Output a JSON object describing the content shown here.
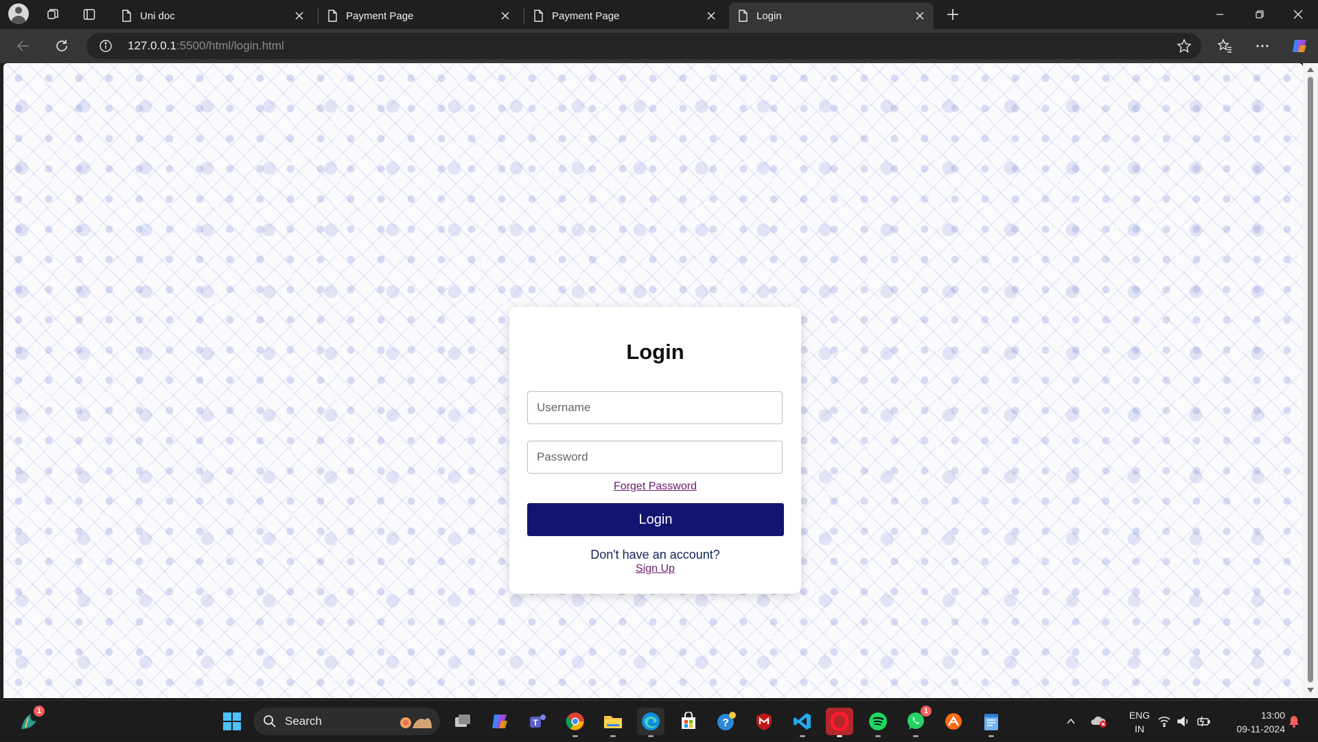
{
  "browser": {
    "tabs": [
      {
        "label": "Uni doc",
        "active": false
      },
      {
        "label": "Payment Page",
        "active": false
      },
      {
        "label": "Payment Page",
        "active": false
      },
      {
        "label": "Login",
        "active": true
      }
    ],
    "url_host": "127.0.0.1",
    "url_rest": ":5500/html/login.html"
  },
  "login": {
    "title": "Login",
    "username_placeholder": "Username",
    "password_placeholder": "Password",
    "forget_password": "Forget Password",
    "login_button": "Login",
    "no_account": "Don't have an account?",
    "sign_up": "Sign Up"
  },
  "colors": {
    "button": "#121570",
    "link": "#6a1a6a",
    "text_dark": "#13245a"
  },
  "taskbar": {
    "search_label": "Search",
    "widgets_badge": "1",
    "whatsapp_badge": "1",
    "language": "ENG",
    "region": "IN",
    "time": "13:00",
    "date": "09-11-2024"
  }
}
